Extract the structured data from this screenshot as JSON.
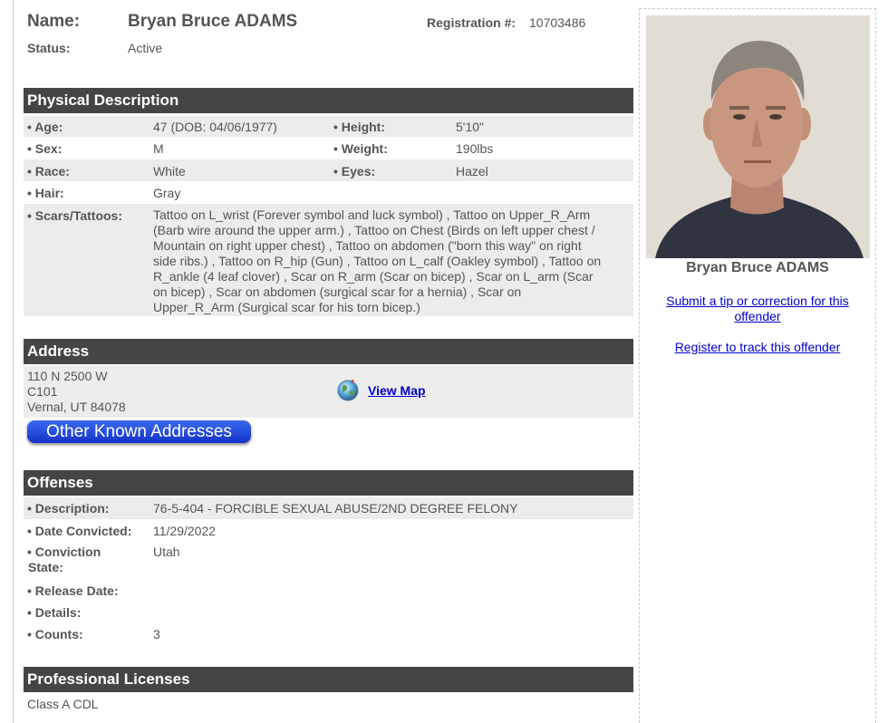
{
  "header": {
    "name_label": "Name:",
    "name_value": "Bryan Bruce ADAMS",
    "registration_label": "Registration #:",
    "registration_value": "10703486",
    "status_label": "Status:",
    "status_value": "Active"
  },
  "physical": {
    "title": "Physical Description",
    "age_label": "• Age:",
    "age_value": "47  (DOB: 04/06/1977)",
    "height_label": "• Height:",
    "height_value": "5'10\"",
    "sex_label": "• Sex:",
    "sex_value": "M",
    "weight_label": "• Weight:",
    "weight_value": "190lbs",
    "race_label": "• Race:",
    "race_value": "White",
    "eyes_label": "• Eyes:",
    "eyes_value": "Hazel",
    "hair_label": "• Hair:",
    "hair_value": "Gray",
    "scars_label": "• Scars/Tattoos:",
    "scars_lines": [
      "Tattoo on L_wrist (Forever symbol and luck symbol) , Tattoo on Upper_R_Arm",
      "(Barb wire around the upper arm.) , Tattoo on Chest (Birds on left upper chest /",
      "Mountain on right upper chest) , Tattoo on abdomen (\"born this way\" on right",
      "side ribs.) , Tattoo on R_hip (Gun) , Tattoo on L_calf (Oakley symbol) , Tattoo on",
      "R_ankle (4 leaf clover) , Scar on R_arm (Scar on bicep) , Scar on L_arm (Scar",
      "on bicep) , Scar on abdomen (surgical scar for a hernia) , Scar on",
      "Upper_R_Arm (Surgical scar for his torn bicep.)"
    ]
  },
  "address": {
    "title": "Address",
    "line1": "110 N 2500 W",
    "line2": "C101",
    "line3": "Vernal, UT 84078",
    "map_icon": "globe-icon",
    "map_link": "View Map",
    "other_button": "Other Known Addresses"
  },
  "offenses": {
    "title": "Offenses",
    "description_label": "• Description:",
    "description_value": "76-5-404 - FORCIBLE SEXUAL ABUSE/2ND DEGREE FELONY",
    "convicted_label": "• Date Convicted:",
    "convicted_value": "11/29/2022",
    "conv_state_label1": "• Conviction",
    "conv_state_label2": "State:",
    "conv_state_value": "Utah",
    "release_label": "• Release Date:",
    "details_label": "• Details:",
    "counts_label": "• Counts:",
    "counts_value": "3"
  },
  "licenses": {
    "title": "Professional Licenses",
    "value": "Class A CDL"
  },
  "sidebar": {
    "photo_name": "Bryan Bruce ADAMS",
    "tip_link_line1": "Submit a tip or correction for this",
    "tip_link_line2": "offender",
    "register_link": "Register to track this offender"
  },
  "colors": {
    "section_header_bg": "#454545",
    "row_shade": "#ececec",
    "link": "#0000cc",
    "button_blue": "#1f44d6"
  }
}
